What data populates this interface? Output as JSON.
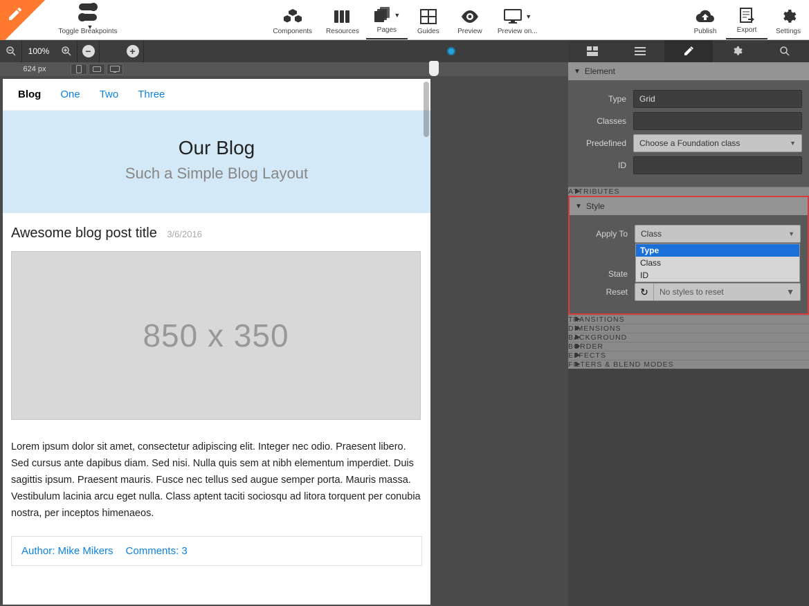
{
  "toolbar": {
    "toggle_breakpoints": "Toggle Breakpoints",
    "components": "Components",
    "resources": "Resources",
    "pages": "Pages",
    "guides": "Guides",
    "preview": "Preview",
    "preview_on": "Preview on...",
    "publish": "Publish",
    "export": "Export",
    "settings": "Settings"
  },
  "zoom": {
    "percent": "100%",
    "width_px": "624 px"
  },
  "nav": {
    "items": [
      "Blog",
      "One",
      "Two",
      "Three"
    ]
  },
  "hero": {
    "title": "Our Blog",
    "subtitle": "Such a Simple Blog Layout"
  },
  "post": {
    "title": "Awesome blog post title",
    "date": "3/6/2016",
    "placeholder": "850 x 350",
    "body": "Lorem ipsum dolor sit amet, consectetur adipiscing elit. Integer nec odio. Praesent libero. Sed cursus ante dapibus diam. Sed nisi. Nulla quis sem at nibh elementum imperdiet. Duis sagittis ipsum. Praesent mauris. Fusce nec tellus sed augue semper porta. Mauris massa. Vestibulum lacinia arcu eget nulla. Class aptent taciti sociosqu ad litora torquent per conubia nostra, per inceptos himenaeos.",
    "author": "Author: Mike Mikers",
    "comments": "Comments: 3"
  },
  "panel": {
    "element": {
      "header": "Element",
      "type_label": "Type",
      "type_value": "Grid",
      "classes_label": "Classes",
      "predefined_label": "Predefined",
      "predefined_placeholder": "Choose a Foundation class",
      "id_label": "ID"
    },
    "attributes_header": "ATTRIBUTES",
    "style": {
      "header": "Style",
      "apply_to_label": "Apply To",
      "apply_to_value": "Class",
      "apply_to_options": [
        "Type",
        "Class",
        "ID"
      ],
      "state_label": "State",
      "reset_label": "Reset",
      "reset_placeholder": "No styles to reset"
    },
    "sections": [
      "TRANSITIONS",
      "DIMENSIONS",
      "BACKGROUND",
      "BORDER",
      "EFFECTS",
      "FILTERS & BLEND MODES"
    ]
  }
}
